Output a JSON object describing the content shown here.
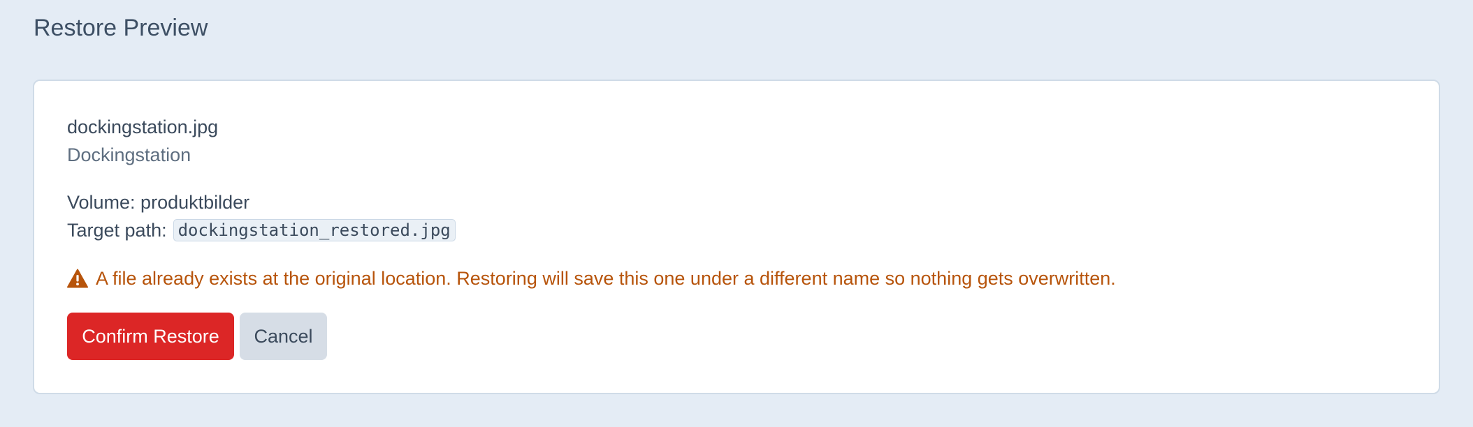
{
  "page": {
    "title": "Restore Preview"
  },
  "file": {
    "name": "dockingstation.jpg",
    "description": "Dockingstation",
    "volume_label": "Volume: produktbilder",
    "target_path_label": "Target path:",
    "target_path": "dockingstation_restored.jpg"
  },
  "warning": {
    "icon": "warning-triangle-icon",
    "message": "A file already exists at the original location. Restoring will save this one under a different name so nothing gets overwritten.",
    "color": "#b7540b"
  },
  "actions": {
    "confirm_label": "Confirm Restore",
    "cancel_label": "Cancel",
    "confirm_color": "#dc2626",
    "cancel_color": "#d6dde6"
  }
}
